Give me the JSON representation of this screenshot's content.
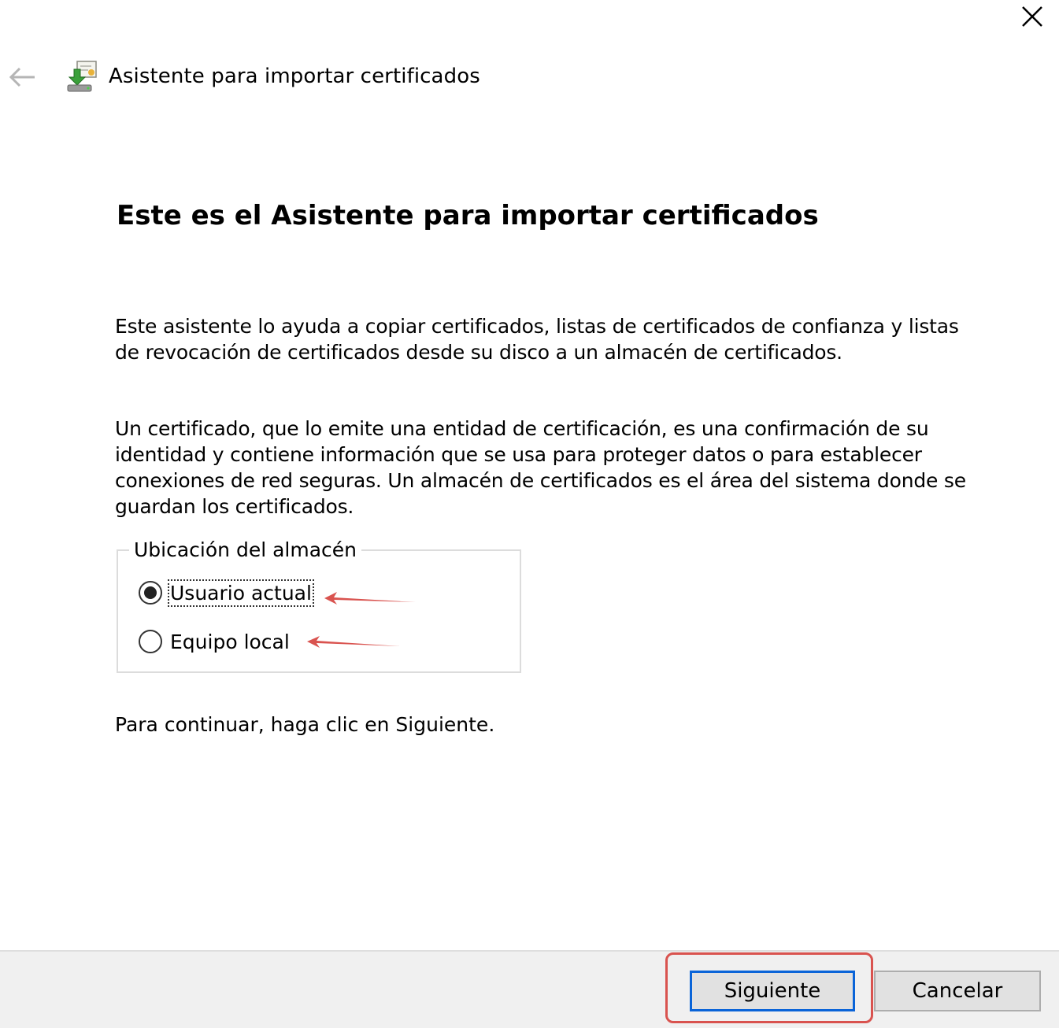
{
  "window": {
    "title": "Asistente para importar certificados",
    "close_icon": "close-icon",
    "back_icon": "back-arrow-icon",
    "app_icon": "certificate-wizard-icon"
  },
  "content": {
    "heading": "Este es el Asistente para importar certificados",
    "paragraph1": "Este asistente lo ayuda a copiar certificados, listas de certificados de confianza y listas de revocación de certificados desde su disco a un almacén de certificados.",
    "paragraph2": "Un certificado, que lo emite una entidad de certificación, es una confirmación de su identidad y contiene información que se usa para proteger datos o para establecer conexiones de red seguras. Un almacén de certificados es el área del sistema donde se guardan los certificados.",
    "store_location": {
      "legend": "Ubicación del almacén",
      "options": [
        {
          "label": "Usuario actual",
          "selected": true
        },
        {
          "label": "Equipo local",
          "selected": false
        }
      ]
    },
    "continue_text": "Para continuar, haga clic en Siguiente."
  },
  "footer": {
    "next_label": "Siguiente",
    "cancel_label": "Cancelar"
  },
  "colors": {
    "annotation": "#d9534f",
    "focus_border": "#0a64d8",
    "footer_bg": "#f0f0f0"
  }
}
